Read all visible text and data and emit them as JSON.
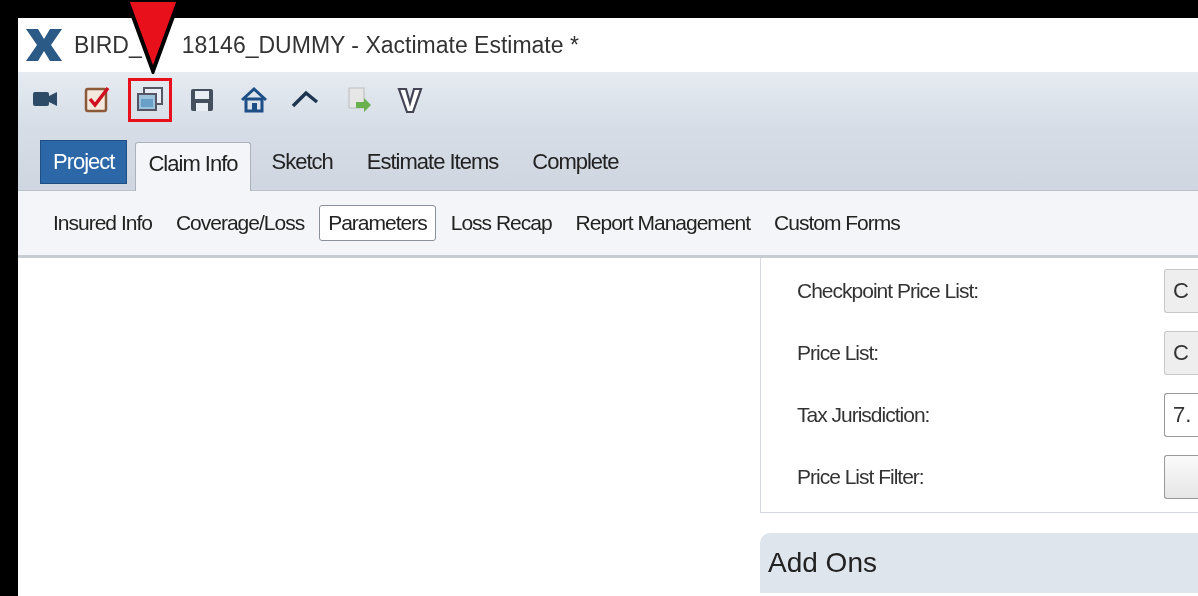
{
  "window": {
    "title_parts": [
      "BIRD_",
      "18146_DUMMY - Xactimate Estimate *"
    ]
  },
  "toolbar": [
    {
      "kind": "camera",
      "highlighted": false
    },
    {
      "kind": "checklist",
      "highlighted": false
    },
    {
      "kind": "windows",
      "highlighted": true
    },
    {
      "kind": "save",
      "highlighted": false
    },
    {
      "kind": "home",
      "highlighted": false
    },
    {
      "kind": "roof",
      "highlighted": false
    },
    {
      "kind": "export",
      "highlighted": false
    },
    {
      "kind": "logo",
      "highlighted": false
    }
  ],
  "tabs": [
    {
      "label": "Project",
      "kind": "project",
      "selected": false
    },
    {
      "label": "Claim Info",
      "kind": "tab",
      "selected": true
    },
    {
      "label": "Sketch",
      "kind": "tab",
      "selected": false
    },
    {
      "label": "Estimate Items",
      "kind": "tab",
      "selected": false
    },
    {
      "label": "Complete",
      "kind": "tab",
      "selected": false
    }
  ],
  "subtabs": [
    {
      "label": "Insured Info",
      "selected": false
    },
    {
      "label": "Coverage/Loss",
      "selected": false
    },
    {
      "label": "Parameters",
      "selected": true
    },
    {
      "label": "Loss Recap",
      "selected": false
    },
    {
      "label": "Report Management",
      "selected": false
    },
    {
      "label": "Custom Forms",
      "selected": false
    }
  ],
  "parameters": [
    {
      "label": "Checkpoint Price List:",
      "value": "C",
      "kind": "readonly"
    },
    {
      "label": "Price List:",
      "value": "C",
      "kind": "readonly"
    },
    {
      "label": "Tax Jurisdiction:",
      "value": "7.",
      "kind": "dropdown"
    },
    {
      "label": "Price List Filter:",
      "kind": "button"
    }
  ],
  "add_ons": {
    "title": "Add Ons"
  }
}
